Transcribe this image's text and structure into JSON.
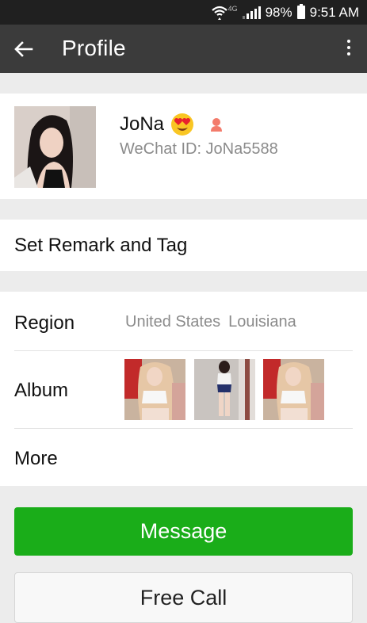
{
  "status_bar": {
    "network_label": "4G",
    "battery": "98%",
    "time": "9:51 AM"
  },
  "app_bar": {
    "title": "Profile"
  },
  "profile": {
    "name": "JoNa",
    "wechat_id": "WeChat ID: JoNa5588"
  },
  "remark": {
    "label": "Set Remark and Tag"
  },
  "details": {
    "region_label": "Region",
    "region_country": "United States",
    "region_state": "Louisiana",
    "album_label": "Album",
    "more_label": "More"
  },
  "actions": {
    "message": "Message",
    "free_call": "Free Call"
  },
  "icons": {
    "back": "arrow-left-icon",
    "menu": "more-vertical-icon",
    "gender": "female-icon",
    "emoji": "heart-eyes-emoji-icon"
  },
  "colors": {
    "status_bar": "#202020",
    "app_bar": "#3b3b3b",
    "message_button": "#1aad19",
    "secondary_text": "#8b8b8b",
    "gender_icon": "#f37b6b"
  }
}
